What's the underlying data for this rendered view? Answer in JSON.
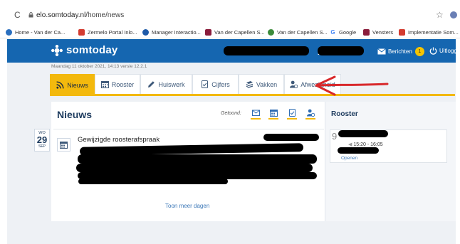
{
  "browser": {
    "reload_glyph": "C",
    "url_host": "elo.somtoday.nl",
    "url_path": "/home/news",
    "bookmarks": [
      {
        "label": "Home - Van der Ca...",
        "icon": "somtoday-icon",
        "color": "#2a6fbf"
      },
      {
        "label": "Zermelo Portal Inlo...",
        "icon": "zermelo-icon",
        "color": "#d33b2f"
      },
      {
        "label": "Manager Interactio...",
        "icon": "manager-icon",
        "color": "#1e5aa8"
      },
      {
        "label": "Van der Capellen S...",
        "icon": "vdc-icon",
        "color": "#8a1c3b"
      },
      {
        "label": "Van der Capellen S...",
        "icon": "vdc-green-icon",
        "color": "#3c8b3a"
      },
      {
        "label": "Google",
        "icon": "google-icon",
        "color": "#4285f4"
      },
      {
        "label": "Vensters",
        "icon": "vensters-icon",
        "color": "#8a1c3b"
      },
      {
        "label": "Implementatie Som...",
        "icon": "implementatie-icon",
        "color": "#d33b2f"
      }
    ]
  },
  "app": {
    "logo_text": "somtoday",
    "messages_label": "Berichten",
    "messages_count": "1",
    "logout_label": "Uitloggen",
    "dateline": "Maandag 11 oktober 2021, 14:13 versie 12.2.1"
  },
  "tabs": [
    {
      "label": "Nieuws",
      "icon": "rss-icon",
      "active": true
    },
    {
      "label": "Rooster",
      "icon": "calendar-icon",
      "active": false
    },
    {
      "label": "Huiswerk",
      "icon": "pencil-icon",
      "active": false
    },
    {
      "label": "Cijfers",
      "icon": "grades-icon",
      "active": false
    },
    {
      "label": "Vakken",
      "icon": "books-icon",
      "active": false
    },
    {
      "label": "Afwezigheid",
      "icon": "absence-icon",
      "active": false
    }
  ],
  "news": {
    "title": "Nieuws",
    "shown_label": "Getoond:",
    "filters": [
      "envelope-icon",
      "calendar-icon",
      "document-icon",
      "person-icon"
    ],
    "date": {
      "weekday": "WO",
      "day": "29",
      "month": "SEP"
    },
    "item_title": "Gewijzigde roosterafspraak",
    "more_label": "Toon meer dagen"
  },
  "rooster": {
    "title": "Rooster",
    "hour_digit": "9",
    "time": "15:20 - 16:05",
    "link": "Openen"
  },
  "colors": {
    "header_blue": "#1566b0",
    "tab_yellow": "#f3b90d",
    "annotation_red": "#d8282b"
  }
}
